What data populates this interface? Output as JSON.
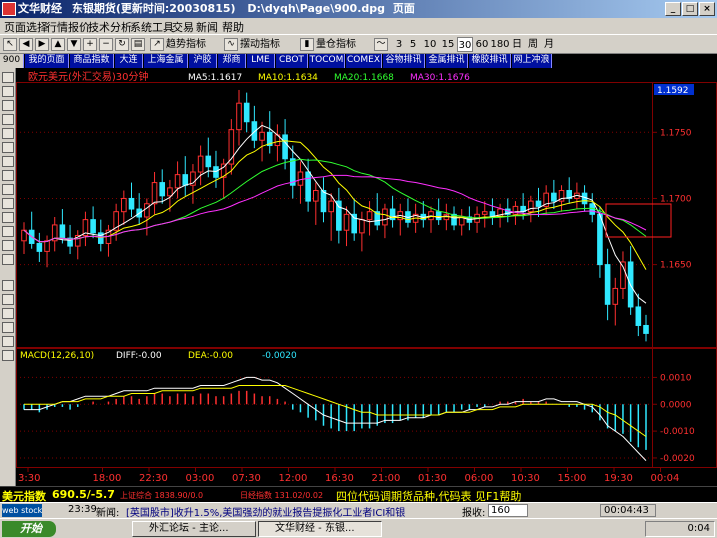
{
  "window": {
    "app_name": "文华财经",
    "title_rest": "东银期货(更新时间:20030815)",
    "file_path": "D:\\dyqh\\Page\\900.dpg",
    "page_word": "页面"
  },
  "menu": [
    "页面选择",
    "行情报价",
    "技术分析",
    "系统工具",
    "交易",
    "新闻",
    "帮助"
  ],
  "toolbar": {
    "trend": "趋势指标",
    "swing": "摆动指标",
    "volume": "量仓指标",
    "periods": [
      "3",
      "5",
      "10",
      "15",
      "30",
      "60",
      "180",
      "日",
      "周",
      "月"
    ]
  },
  "tabs": [
    "900",
    "我的页面",
    "商品指数",
    "大连",
    "上海金属",
    "沪胶",
    "郑商",
    "LME",
    "CBOT",
    "TOCOM",
    "COMEX",
    "谷物排讯",
    "金属排讯",
    "橡胶排讯",
    "网上冲浪"
  ],
  "price_panel": {
    "title": "欧元美元(外汇交易)30分钟",
    "ma5": "MA5:1.1617",
    "ma10": "MA10:1.1634",
    "ma20": "MA20:1.1668",
    "ma30": "MA30:1.1676",
    "last_price": "1.1592",
    "y_ticks": [
      "1.1750",
      "1.1700",
      "1.1650"
    ]
  },
  "macd_panel": {
    "title": "MACD(12,26,10)",
    "diff": "DIFF:-0.00",
    "dea": "DEA:-0.00",
    "macd": "-0.0020",
    "y_ticks": [
      "0.0010",
      "0.0000",
      "-0.0010",
      "-0.0020"
    ]
  },
  "time_axis": [
    "3:30",
    "18:00",
    "22:30",
    "03:00",
    "07:30",
    "12:00",
    "16:30",
    "21:00",
    "01:30",
    "06:00",
    "10:30",
    "15:00",
    "19:30",
    "00:04"
  ],
  "colors": {
    "up": "#ff3030",
    "down": "#30e8ff",
    "ma5": "#ffffff",
    "ma10": "#ffff00",
    "ma20": "#30ff30",
    "ma30": "#ff30ff",
    "grid": "#800000"
  },
  "chart_data": {
    "type": "candlestick",
    "title": "欧元美元(外汇交易)30分钟",
    "ylim": [
      1.159,
      1.1785
    ],
    "candles": [
      [
        1.1668,
        1.1682,
        1.1658,
        1.1676
      ],
      [
        1.1676,
        1.169,
        1.1662,
        1.1666
      ],
      [
        1.1666,
        1.1674,
        1.1652,
        1.166
      ],
      [
        1.166,
        1.1672,
        1.1648,
        1.1668
      ],
      [
        1.1668,
        1.1686,
        1.166,
        1.168
      ],
      [
        1.168,
        1.1692,
        1.1666,
        1.167
      ],
      [
        1.167,
        1.168,
        1.1658,
        1.1664
      ],
      [
        1.1664,
        1.1676,
        1.1654,
        1.1672
      ],
      [
        1.1672,
        1.169,
        1.1664,
        1.1684
      ],
      [
        1.1684,
        1.1694,
        1.167,
        1.1674
      ],
      [
        1.1674,
        1.1684,
        1.166,
        1.1666
      ],
      [
        1.1666,
        1.168,
        1.1656,
        1.1676
      ],
      [
        1.1676,
        1.1696,
        1.1668,
        1.169
      ],
      [
        1.169,
        1.1706,
        1.168,
        1.17
      ],
      [
        1.17,
        1.1712,
        1.1686,
        1.1692
      ],
      [
        1.1692,
        1.1704,
        1.168,
        1.1686
      ],
      [
        1.1686,
        1.17,
        1.1672,
        1.1696
      ],
      [
        1.1696,
        1.172,
        1.1688,
        1.1712
      ],
      [
        1.1712,
        1.1722,
        1.1696,
        1.1702
      ],
      [
        1.1702,
        1.1714,
        1.169,
        1.1708
      ],
      [
        1.1708,
        1.1728,
        1.17,
        1.1718
      ],
      [
        1.1718,
        1.1732,
        1.1702,
        1.171
      ],
      [
        1.171,
        1.1726,
        1.1696,
        1.172
      ],
      [
        1.172,
        1.174,
        1.171,
        1.1732
      ],
      [
        1.1732,
        1.1746,
        1.1716,
        1.1724
      ],
      [
        1.1724,
        1.1736,
        1.1708,
        1.1716
      ],
      [
        1.1716,
        1.173,
        1.17,
        1.1726
      ],
      [
        1.1726,
        1.176,
        1.1718,
        1.1752
      ],
      [
        1.1752,
        1.1782,
        1.174,
        1.1772
      ],
      [
        1.1772,
        1.178,
        1.175,
        1.1758
      ],
      [
        1.1758,
        1.177,
        1.1738,
        1.1744
      ],
      [
        1.1744,
        1.1758,
        1.1728,
        1.175
      ],
      [
        1.175,
        1.1766,
        1.1734,
        1.174
      ],
      [
        1.174,
        1.1756,
        1.1728,
        1.1748
      ],
      [
        1.1748,
        1.176,
        1.1722,
        1.173
      ],
      [
        1.173,
        1.174,
        1.17,
        1.171
      ],
      [
        1.171,
        1.1728,
        1.1696,
        1.172
      ],
      [
        1.172,
        1.173,
        1.169,
        1.1698
      ],
      [
        1.1698,
        1.1712,
        1.168,
        1.1706
      ],
      [
        1.1706,
        1.1716,
        1.1682,
        1.169
      ],
      [
        1.169,
        1.1704,
        1.1668,
        1.1698
      ],
      [
        1.1698,
        1.1708,
        1.1666,
        1.1676
      ],
      [
        1.1676,
        1.1694,
        1.1664,
        1.1688
      ],
      [
        1.1688,
        1.17,
        1.1668,
        1.1674
      ],
      [
        1.1674,
        1.169,
        1.166,
        1.1684
      ],
      [
        1.1684,
        1.1698,
        1.1672,
        1.169
      ],
      [
        1.169,
        1.1704,
        1.1676,
        1.168
      ],
      [
        1.168,
        1.1696,
        1.167,
        1.1692
      ],
      [
        1.1692,
        1.1702,
        1.1678,
        1.1684
      ],
      [
        1.1684,
        1.1696,
        1.1672,
        1.169
      ],
      [
        1.169,
        1.17,
        1.1678,
        1.1682
      ],
      [
        1.1682,
        1.1696,
        1.1674,
        1.1688
      ],
      [
        1.1688,
        1.1698,
        1.1678,
        1.1684
      ],
      [
        1.1684,
        1.1694,
        1.1674,
        1.169
      ],
      [
        1.169,
        1.17,
        1.168,
        1.1684
      ],
      [
        1.1684,
        1.1696,
        1.1676,
        1.1688
      ],
      [
        1.1688,
        1.1694,
        1.1676,
        1.168
      ],
      [
        1.168,
        1.1692,
        1.1672,
        1.1686
      ],
      [
        1.1686,
        1.1694,
        1.1676,
        1.1682
      ],
      [
        1.1682,
        1.1694,
        1.1674,
        1.1688
      ],
      [
        1.1688,
        1.1698,
        1.1678,
        1.169
      ],
      [
        1.169,
        1.17,
        1.168,
        1.1686
      ],
      [
        1.1686,
        1.1696,
        1.1678,
        1.1692
      ],
      [
        1.1692,
        1.17,
        1.1682,
        1.1688
      ],
      [
        1.1688,
        1.1698,
        1.168,
        1.1694
      ],
      [
        1.1694,
        1.1704,
        1.1684,
        1.169
      ],
      [
        1.169,
        1.1702,
        1.1682,
        1.1698
      ],
      [
        1.1698,
        1.1708,
        1.1686,
        1.1694
      ],
      [
        1.1694,
        1.171,
        1.1688,
        1.1704
      ],
      [
        1.1704,
        1.1714,
        1.1692,
        1.1698
      ],
      [
        1.1698,
        1.171,
        1.169,
        1.1706
      ],
      [
        1.1706,
        1.1716,
        1.1696,
        1.17
      ],
      [
        1.17,
        1.1712,
        1.1692,
        1.1704
      ],
      [
        1.1704,
        1.171,
        1.169,
        1.1696
      ],
      [
        1.1696,
        1.1704,
        1.1682,
        1.1688
      ],
      [
        1.1688,
        1.1694,
        1.164,
        1.165
      ],
      [
        1.165,
        1.1662,
        1.1608,
        1.162
      ],
      [
        1.162,
        1.164,
        1.1604,
        1.1632
      ],
      [
        1.1632,
        1.166,
        1.1624,
        1.1652
      ],
      [
        1.1652,
        1.1664,
        1.1612,
        1.1618
      ],
      [
        1.1618,
        1.1628,
        1.1596,
        1.1604
      ],
      [
        1.1604,
        1.1612,
        1.1592,
        1.1598
      ]
    ],
    "macd": {
      "ylim": [
        -0.0023,
        0.0015
      ],
      "hist": [
        -0.0002,
        -0.0002,
        -0.0003,
        -0.0002,
        -0.0001,
        -0.0001,
        -0.0002,
        -0.0001,
        0.0,
        0.0001,
        0.0,
        0.0001,
        0.0002,
        0.0003,
        0.0003,
        0.0002,
        0.0003,
        0.0004,
        0.0004,
        0.0003,
        0.0004,
        0.0004,
        0.0003,
        0.0004,
        0.0004,
        0.0003,
        0.0003,
        0.0004,
        0.0005,
        0.0005,
        0.0004,
        0.0003,
        0.0003,
        0.0002,
        0.0001,
        -0.0002,
        -0.0003,
        -0.0005,
        -0.0006,
        -0.0008,
        -0.0009,
        -0.001,
        -0.001,
        -0.001,
        -0.0009,
        -0.0009,
        -0.0008,
        -0.0007,
        -0.0007,
        -0.0006,
        -0.0006,
        -0.0005,
        -0.0005,
        -0.0004,
        -0.0004,
        -0.0003,
        -0.0003,
        -0.0002,
        -0.0002,
        -0.0001,
        -0.0001,
        0.0,
        0.0001,
        0.0001,
        0.0001,
        0.0002,
        0.0001,
        0.0001,
        0.0001,
        0.0,
        0.0,
        -0.0001,
        -0.0001,
        -0.0002,
        -0.0003,
        -0.0006,
        -0.0009,
        -0.001,
        -0.0011,
        -0.0014,
        -0.0016,
        -0.0017
      ],
      "diff": [
        -0.0002,
        -0.0002,
        -0.0002,
        -0.0001,
        0.0,
        0.0001,
        0.0001,
        0.0002,
        0.0003,
        0.0003,
        0.0003,
        0.0003,
        0.0004,
        0.0005,
        0.0005,
        0.0005,
        0.0005,
        0.0006,
        0.0006,
        0.0006,
        0.0006,
        0.0006,
        0.0006,
        0.0007,
        0.0007,
        0.0007,
        0.0007,
        0.0008,
        0.0009,
        0.001,
        0.001,
        0.0009,
        0.0009,
        0.0008,
        0.0006,
        0.0004,
        0.0002,
        0.0,
        -0.0002,
        -0.0004,
        -0.0005,
        -0.0006,
        -0.0007,
        -0.0007,
        -0.0007,
        -0.0007,
        -0.0007,
        -0.0006,
        -0.0006,
        -0.0006,
        -0.0005,
        -0.0005,
        -0.0005,
        -0.0004,
        -0.0004,
        -0.0003,
        -0.0003,
        -0.0003,
        -0.0002,
        -0.0002,
        -0.0001,
        -0.0001,
        0.0,
        0.0,
        0.0001,
        0.0001,
        0.0001,
        0.0001,
        0.0002,
        0.0002,
        0.0001,
        0.0001,
        0.0001,
        0.0,
        -0.0001,
        -0.0004,
        -0.0008,
        -0.001,
        -0.0012,
        -0.0015,
        -0.0018,
        -0.0021
      ],
      "dea": [
        0.0,
        0.0,
        0.0,
        0.0,
        0.0,
        0.0001,
        0.0001,
        0.0001,
        0.0002,
        0.0002,
        0.0002,
        0.0003,
        0.0003,
        0.0003,
        0.0004,
        0.0004,
        0.0004,
        0.0004,
        0.0005,
        0.0005,
        0.0005,
        0.0005,
        0.0005,
        0.0006,
        0.0006,
        0.0006,
        0.0006,
        0.0006,
        0.0007,
        0.0007,
        0.0007,
        0.0007,
        0.0007,
        0.0007,
        0.0007,
        0.0006,
        0.0005,
        0.0004,
        0.0003,
        0.0002,
        0.0001,
        0.0,
        -0.0001,
        -0.0002,
        -0.0003,
        -0.0003,
        -0.0004,
        -0.0004,
        -0.0004,
        -0.0004,
        -0.0004,
        -0.0004,
        -0.0004,
        -0.0004,
        -0.0004,
        -0.0003,
        -0.0003,
        -0.0003,
        -0.0003,
        -0.0002,
        -0.0002,
        -0.0002,
        -0.0001,
        -0.0001,
        -0.0001,
        0.0,
        0.0,
        0.0,
        0.0,
        0.0,
        0.0,
        0.0,
        0.0,
        0.0,
        0.0,
        -0.0001,
        -0.0003,
        -0.0004,
        -0.0006,
        -0.0008,
        -0.001,
        -0.0012
      ]
    }
  },
  "status": {
    "index_name": "美元指数",
    "index_value": "690.5/-5.7",
    "mid1": "上证综合 1838.90/0.0",
    "mid2": "日经指数 131.02/0.02",
    "promo": "四位代码调期货品种,代码表 见F1帮助"
  },
  "news": {
    "time": "23:39",
    "label": "新闻:",
    "text": "[英国股市]收升1.5%,美国强劲的就业报告提振化工业者ICI和银",
    "order_label": "报收:",
    "order_value": "160",
    "clock": "00:04:43"
  },
  "taskbar": {
    "start": "开始",
    "task1": "外汇论坛 - 主论...",
    "task2": "文华财经 - 东银...",
    "clock": "0:04"
  }
}
